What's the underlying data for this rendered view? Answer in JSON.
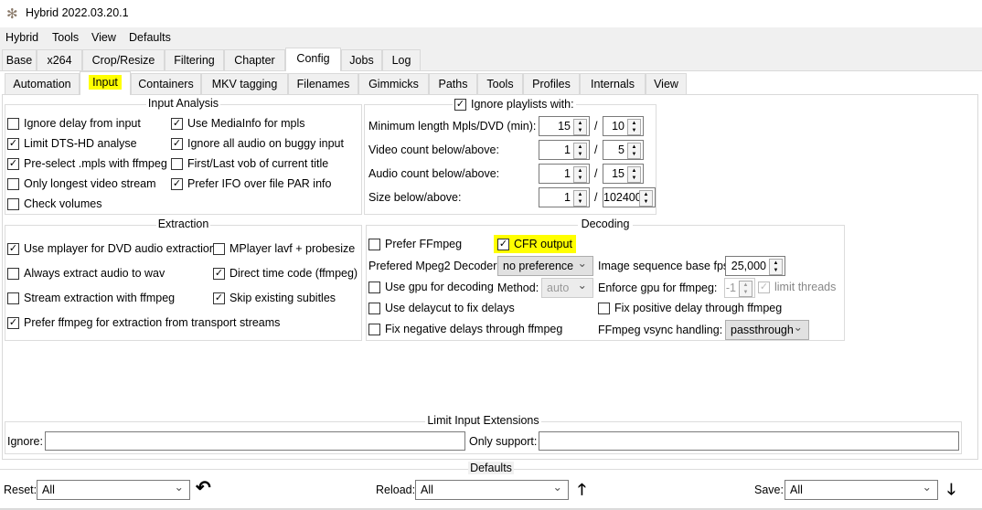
{
  "window": {
    "title": "Hybrid 2022.03.20.1"
  },
  "menu": [
    "Hybrid",
    "Tools",
    "View",
    "Defaults"
  ],
  "main_tabs": [
    "Base",
    "x264",
    "Crop/Resize",
    "Filtering",
    "Chapter",
    "Config",
    "Jobs",
    "Log"
  ],
  "sub_tabs": [
    "Automation",
    "Input",
    "Containers",
    "MKV tagging",
    "Filenames",
    "Gimmicks",
    "Paths",
    "Tools",
    "Profiles",
    "Internals",
    "View"
  ],
  "input_analysis": {
    "title": "Input Analysis",
    "items": [
      {
        "label": "Ignore delay from input",
        "checked": false
      },
      {
        "label": "Limit DTS-HD analyse",
        "checked": true
      },
      {
        "label": "Pre-select .mpls with ffmpeg",
        "checked": true
      },
      {
        "label": "Only longest video stream",
        "checked": false
      },
      {
        "label": "Check volumes",
        "checked": false
      },
      {
        "label": "Use MediaInfo for mpls",
        "checked": true
      },
      {
        "label": "Ignore all audio on buggy input",
        "checked": true
      },
      {
        "label": "First/Last vob of current title",
        "checked": false
      },
      {
        "label": "Prefer IFO over file PAR info",
        "checked": true
      }
    ]
  },
  "playlists": {
    "title": "Ignore playlists with:",
    "checked": true,
    "rows": [
      {
        "label": "Minimum length Mpls/DVD (min):",
        "a": "15",
        "b": "10"
      },
      {
        "label": "Video count below/above:",
        "a": "1",
        "b": "5"
      },
      {
        "label": "Audio count below/above:",
        "a": "1",
        "b": "15"
      },
      {
        "label": "Size below/above:",
        "a": "1",
        "b": "102400"
      }
    ],
    "sep": "/"
  },
  "extraction": {
    "title": "Extraction",
    "items": [
      {
        "label": "Use mplayer for DVD audio extraction",
        "checked": true
      },
      {
        "label": "Always extract audio to wav",
        "checked": false
      },
      {
        "label": "Stream extraction with ffmpeg",
        "checked": false
      },
      {
        "label": "Prefer ffmpeg for extraction from transport streams",
        "checked": true
      },
      {
        "label": "MPlayer lavf + probesize",
        "checked": false
      },
      {
        "label": "Direct time code (ffmpeg)",
        "checked": true
      },
      {
        "label": "Skip existing subitles",
        "checked": true
      }
    ]
  },
  "decoding": {
    "title": "Decoding",
    "prefer_ffmpeg": "Prefer FFmpeg",
    "cfr_output": "CFR output",
    "mpeg2_label": "Prefered Mpeg2 Decoder:",
    "mpeg2_value": "no preference",
    "fps_label": "Image sequence base fps:",
    "fps_value": "25,000",
    "use_gpu": "Use gpu for decoding",
    "method_label": "Method:",
    "method_value": "auto",
    "enforce_label": "Enforce gpu for ffmpeg:",
    "enforce_value": "-1",
    "limit_threads": "limit threads",
    "delaycut": "Use delaycut to fix delays",
    "fix_positive": "Fix positive delay through ffmpeg",
    "fix_negative": "Fix negative delays through ffmpeg",
    "vsync_label": "FFmpeg vsync handling:",
    "vsync_value": "passthrough"
  },
  "extensions": {
    "title": "Limit Input Extensions",
    "ignore_label": "Ignore:",
    "ignore_value": "",
    "only_label": "Only support:",
    "only_value": ""
  },
  "defaults": {
    "title": "Defaults",
    "reset_label": "Reset:",
    "reset_value": "All",
    "reload_label": "Reload:",
    "reload_value": "All",
    "save_label": "Save:",
    "save_value": "All"
  },
  "colors": {
    "highlight": "#ffff00"
  }
}
